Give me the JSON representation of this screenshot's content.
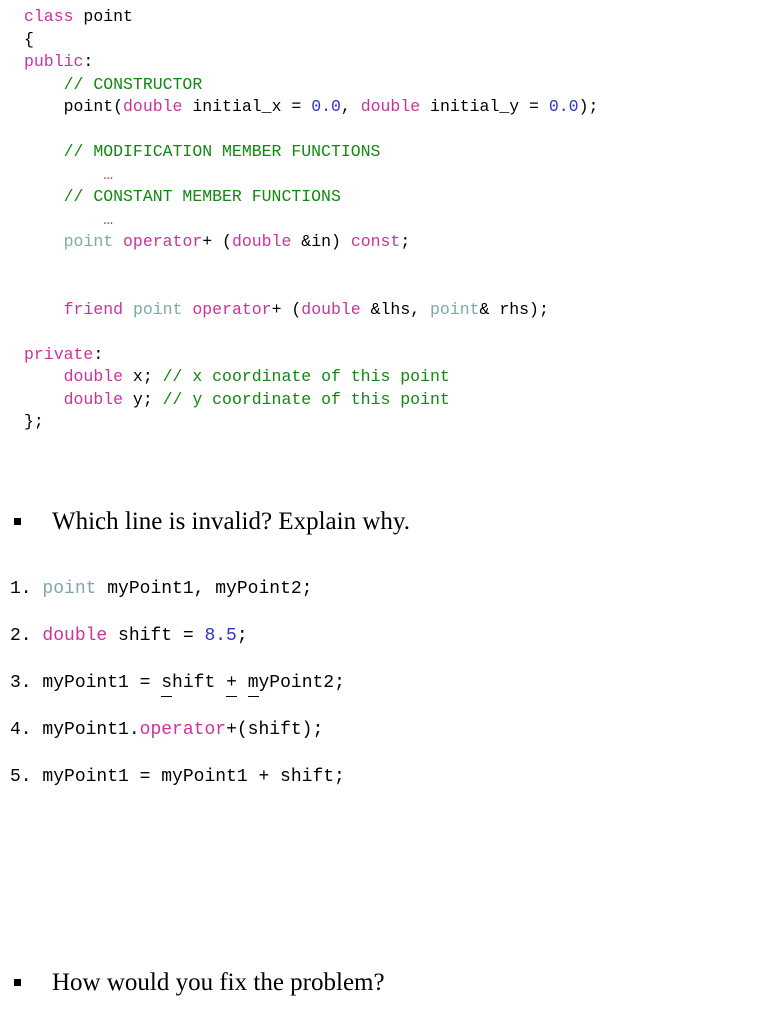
{
  "slide": {
    "background_color": "#ffffff",
    "text_color": "#000000"
  },
  "palette": {
    "keyword": "#cc3399",
    "comment": "#118811",
    "number": "#3333cc",
    "type_name": "#7fa8a8",
    "plain": "#000000"
  },
  "code_block": {
    "language": "C++",
    "lines": [
      {
        "n": 1,
        "indent": 0,
        "tokens": [
          {
            "t": "class",
            "c": "kw"
          },
          {
            "t": " point",
            "c": "pl"
          }
        ]
      },
      {
        "n": 2,
        "indent": 0,
        "tokens": [
          {
            "t": "{",
            "c": "pl"
          }
        ]
      },
      {
        "n": 3,
        "indent": 0,
        "tokens": [
          {
            "t": "public",
            "c": "kw"
          },
          {
            "t": ":",
            "c": "pl"
          }
        ]
      },
      {
        "n": 4,
        "indent": 1,
        "tokens": [
          {
            "t": "// CONSTRUCTOR",
            "c": "cmt"
          }
        ]
      },
      {
        "n": 5,
        "indent": 1,
        "tokens": [
          {
            "t": "point(",
            "c": "pl"
          },
          {
            "t": "double",
            "c": "kw"
          },
          {
            "t": " initial_x = ",
            "c": "pl"
          },
          {
            "t": "0.0",
            "c": "num"
          },
          {
            "t": ", ",
            "c": "pl"
          },
          {
            "t": "double",
            "c": "kw"
          },
          {
            "t": " initial_y = ",
            "c": "pl"
          },
          {
            "t": "0.0",
            "c": "num"
          },
          {
            "t": ");",
            "c": "pl"
          }
        ]
      },
      {
        "n": 6,
        "indent": 0,
        "blank": true,
        "tokens": []
      },
      {
        "n": 7,
        "indent": 1,
        "tokens": [
          {
            "t": "// MODIFICATION MEMBER FUNCTIONS",
            "c": "cmt"
          }
        ]
      },
      {
        "n": 8,
        "indent": 2,
        "tokens": [
          {
            "t": "…",
            "c": "ell"
          }
        ]
      },
      {
        "n": 9,
        "indent": 1,
        "tokens": [
          {
            "t": "// CONSTANT MEMBER FUNCTIONS",
            "c": "cmt"
          }
        ]
      },
      {
        "n": 10,
        "indent": 2,
        "tokens": [
          {
            "t": "…",
            "c": "ell"
          }
        ]
      },
      {
        "n": 11,
        "indent": 1,
        "tokens": [
          {
            "t": "point",
            "c": "typ"
          },
          {
            "t": " ",
            "c": "pl"
          },
          {
            "t": "operator",
            "c": "kw"
          },
          {
            "t": "+ (",
            "c": "pl"
          },
          {
            "t": "double",
            "c": "kw"
          },
          {
            "t": " &in) ",
            "c": "pl"
          },
          {
            "t": "const",
            "c": "kw"
          },
          {
            "t": ";",
            "c": "pl"
          }
        ]
      },
      {
        "n": 12,
        "indent": 0,
        "blank": true,
        "tokens": []
      },
      {
        "n": 13,
        "indent": 0,
        "blank": true,
        "tokens": []
      },
      {
        "n": 14,
        "indent": 1,
        "tokens": [
          {
            "t": "friend",
            "c": "kw"
          },
          {
            "t": " ",
            "c": "pl"
          },
          {
            "t": "point",
            "c": "typ"
          },
          {
            "t": " ",
            "c": "pl"
          },
          {
            "t": "operator",
            "c": "kw"
          },
          {
            "t": "+ (",
            "c": "pl"
          },
          {
            "t": "double",
            "c": "kw"
          },
          {
            "t": " &lhs, ",
            "c": "pl"
          },
          {
            "t": "point",
            "c": "typ"
          },
          {
            "t": "& rhs);",
            "c": "pl"
          }
        ]
      },
      {
        "n": 15,
        "indent": 0,
        "blank": true,
        "tokens": []
      },
      {
        "n": 16,
        "indent": 0,
        "tokens": [
          {
            "t": "private",
            "c": "kw"
          },
          {
            "t": ":",
            "c": "pl"
          }
        ]
      },
      {
        "n": 17,
        "indent": 1,
        "tokens": [
          {
            "t": "double",
            "c": "kw"
          },
          {
            "t": " x; ",
            "c": "pl"
          },
          {
            "t": "// x coordinate of this point",
            "c": "cmt"
          }
        ]
      },
      {
        "n": 18,
        "indent": 1,
        "tokens": [
          {
            "t": "double",
            "c": "kw"
          },
          {
            "t": " y; ",
            "c": "pl"
          },
          {
            "t": "// y coordinate of this point",
            "c": "cmt"
          }
        ]
      },
      {
        "n": 19,
        "indent": 0,
        "tokens": [
          {
            "t": "};",
            "c": "pl"
          }
        ]
      }
    ]
  },
  "bullets": {
    "which_line": {
      "marker": "square-bullet",
      "text": "Which line is invalid? Explain why."
    },
    "how_fix": {
      "marker": "square-bullet",
      "text": "How would you fix the problem?"
    }
  },
  "numbered_code": {
    "items": [
      {
        "index": "1.",
        "tokens": [
          {
            "t": " ",
            "c": "pl"
          },
          {
            "t": "point",
            "c": "typ"
          },
          {
            "t": " myPoint1, myPoint2;",
            "c": "pl"
          }
        ]
      },
      {
        "index": "2.",
        "tokens": [
          {
            "t": " ",
            "c": "pl"
          },
          {
            "t": "double",
            "c": "kw"
          },
          {
            "t": " shift = ",
            "c": "pl"
          },
          {
            "t": "8.5",
            "c": "num"
          },
          {
            "t": ";",
            "c": "pl"
          }
        ]
      },
      {
        "index": "3.",
        "tokens": [
          {
            "t": " myPoint1 = ",
            "c": "pl"
          },
          {
            "t": "shift",
            "c": "pl",
            "underline": "partial"
          },
          {
            "t": " ",
            "c": "pl"
          },
          {
            "t": "+",
            "c": "pl",
            "underline": "full"
          },
          {
            "t": " ",
            "c": "pl"
          },
          {
            "t": "myPoint2",
            "c": "pl",
            "underline": "partial"
          },
          {
            "t": ";",
            "c": "pl"
          }
        ]
      },
      {
        "index": "4.",
        "tokens": [
          {
            "t": " myPoint1.",
            "c": "pl"
          },
          {
            "t": "operator",
            "c": "kw"
          },
          {
            "t": "+(shift);",
            "c": "pl"
          }
        ]
      },
      {
        "index": "5.",
        "tokens": [
          {
            "t": " myPoint1 = myPoint1 + shift;",
            "c": "pl"
          }
        ]
      }
    ]
  }
}
